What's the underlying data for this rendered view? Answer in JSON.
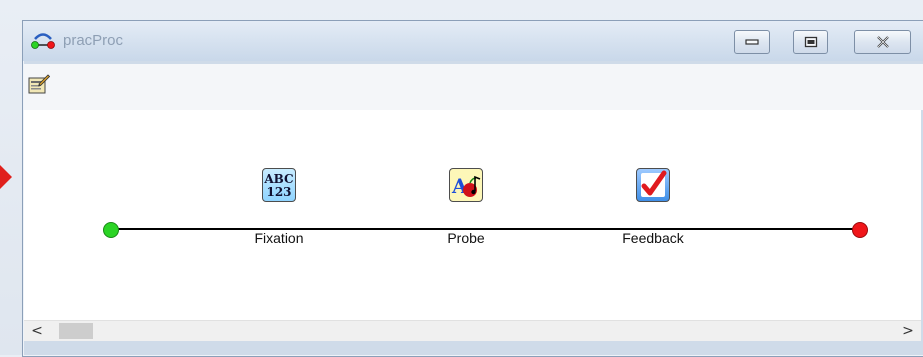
{
  "window": {
    "title": "pracProc"
  },
  "procedure": {
    "objects": [
      {
        "label": "Fixation",
        "icon": "text-display-icon",
        "icon_text_top": "ABC",
        "icon_text_bottom": "123"
      },
      {
        "label": "Probe",
        "icon": "slide-icon"
      },
      {
        "label": "Feedback",
        "icon": "feedback-checkmark-icon"
      }
    ],
    "start_node_color": "#2bd425",
    "end_node_color": "#f0161a"
  },
  "scrollbar": {
    "left_arrow": "<",
    "right_arrow": ">"
  }
}
